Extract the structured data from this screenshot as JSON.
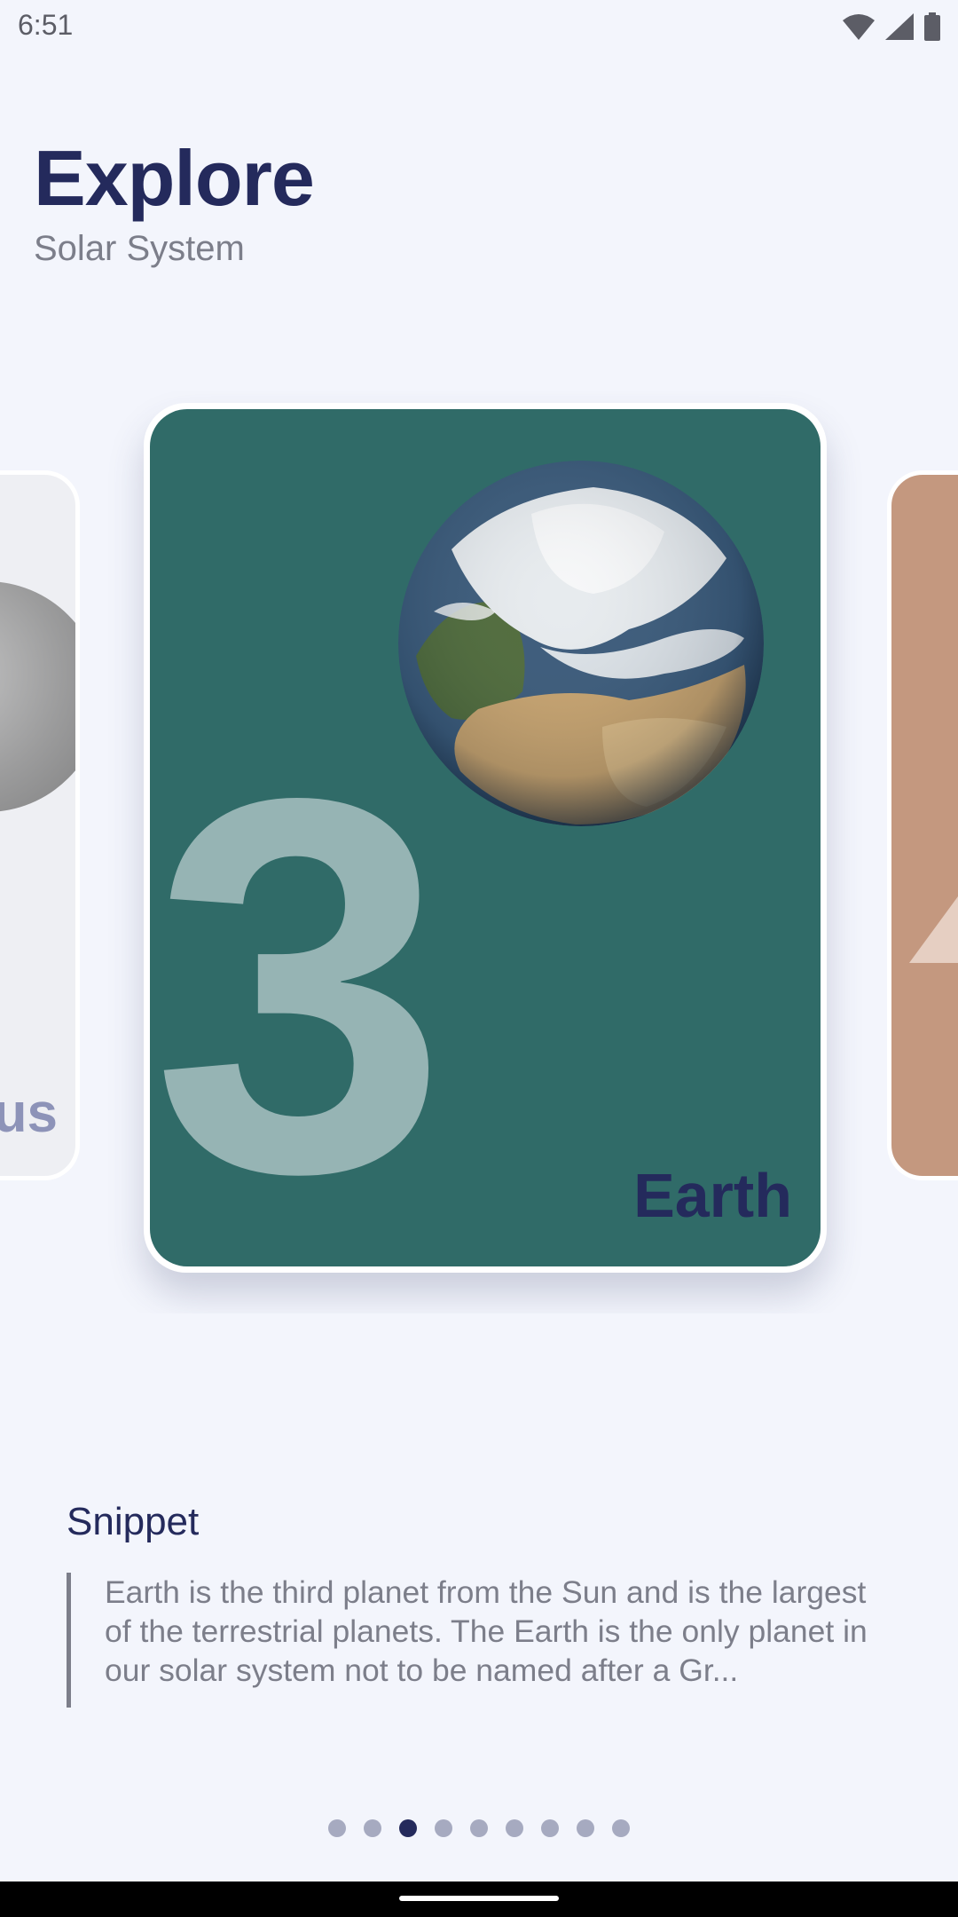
{
  "status": {
    "time": "6:51",
    "icons": [
      "wifi-icon",
      "signal-icon",
      "battery-icon"
    ]
  },
  "header": {
    "title": "Explore",
    "subtitle": "Solar System"
  },
  "carousel": {
    "prev_card": {
      "name": "us",
      "color": "#eeeff3"
    },
    "current_card": {
      "number": "3",
      "name": "Earth",
      "color": "#306b68",
      "image": "earth-globe-icon"
    },
    "next_card": {
      "color": "#c4987f"
    }
  },
  "snippet": {
    "heading": "Snippet",
    "text": "Earth is the third planet from the Sun and is the largest of the terrestrial planets. The Earth is the only planet in our solar system not to be named after a Gr..."
  },
  "pager": {
    "total": 9,
    "active_index": 2
  },
  "colors": {
    "accent": "#242a5c",
    "background": "#f3f5fc"
  }
}
